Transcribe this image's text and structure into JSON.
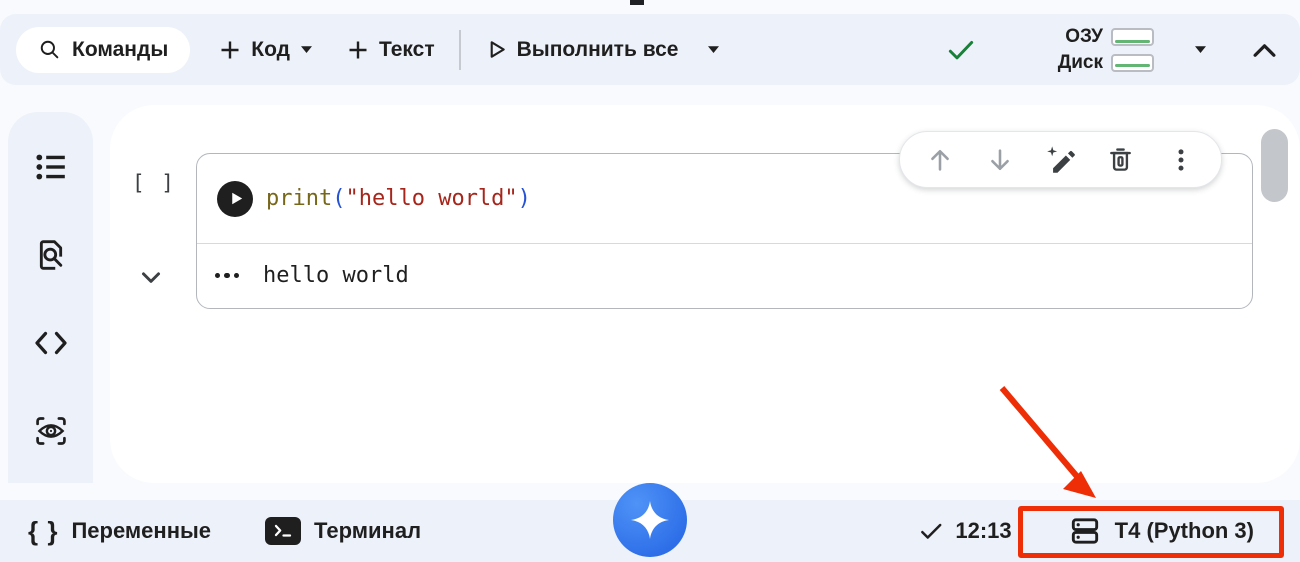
{
  "topbar": {
    "commands_label": "Команды",
    "add_code_label": "Код",
    "add_text_label": "Текст",
    "run_all_label": "Выполнить все",
    "ram_label": "ОЗУ",
    "disk_label": "Диск"
  },
  "sidebar": {
    "items": [
      {
        "name": "table-of-contents"
      },
      {
        "name": "find-and-replace"
      },
      {
        "name": "code-snippets"
      },
      {
        "name": "variable-inspector"
      }
    ]
  },
  "cell": {
    "execution_indicator": "[ ]",
    "code_tokens": [
      {
        "t": "print",
        "color": "#77671b"
      },
      {
        "t": "(",
        "color": "#2653d4"
      },
      {
        "t": "\"hello world\"",
        "color": "#a6261b"
      },
      {
        "t": ")",
        "color": "#2653d4"
      }
    ],
    "output_text": "hello world"
  },
  "cell_toolbar": {
    "icons": [
      "move-cell-up",
      "move-cell-down",
      "edit-with-ai",
      "delete-cell",
      "more-actions"
    ]
  },
  "statusbar": {
    "variables_label": "Переменные",
    "terminal_label": "Терминал",
    "execution_time": "12:13",
    "runtime_label": "T4 (Python 3)"
  },
  "colors": {
    "annotation_red": "#ee2e06",
    "check_green": "#188038",
    "gemini_blue": "#3c7ef0",
    "meter_green": "#63b574",
    "surface": "#edf1f9",
    "background": "#f8fafd"
  }
}
